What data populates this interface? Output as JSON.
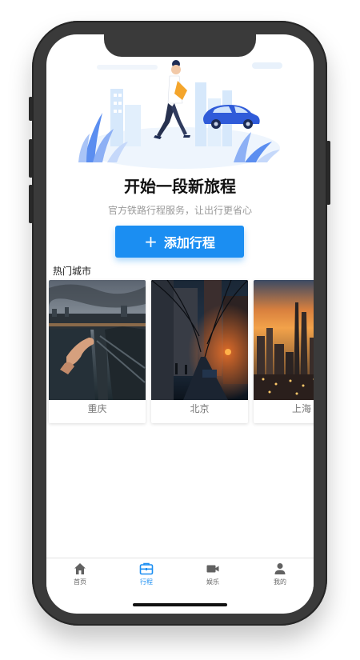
{
  "hero": {
    "title": "开始一段新旅程",
    "subtitle": "官方铁路行程服务，让出行更省心",
    "add_button_icon": "plus-icon",
    "add_button_label": "添加行程"
  },
  "hot_cities": {
    "label": "热门城市",
    "cities": [
      {
        "name": "重庆"
      },
      {
        "name": "北京"
      },
      {
        "name": "上海"
      }
    ]
  },
  "tabbar": {
    "items": [
      {
        "label": "首页",
        "icon": "home-icon",
        "active": false
      },
      {
        "label": "行程",
        "icon": "briefcase-icon",
        "active": true
      },
      {
        "label": "娱乐",
        "icon": "video-camera-icon",
        "active": false
      },
      {
        "label": "我的",
        "icon": "user-icon",
        "active": false
      }
    ]
  },
  "colors": {
    "accent": "#1b8ef2",
    "inactive_icon": "#616161",
    "device_frame": "#3a3a3a"
  }
}
